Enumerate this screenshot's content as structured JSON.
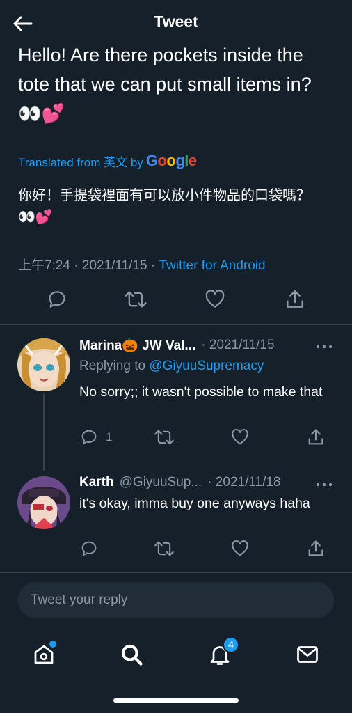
{
  "header": {
    "title": "Tweet"
  },
  "tweet": {
    "text": "Hello! Are there pockets inside the tote that we can put small items in? 👀💕",
    "translated_prefix": "Translated from 英文 by",
    "google_letters": [
      "G",
      "o",
      "o",
      "g",
      "l",
      "e"
    ],
    "translation": "你好！手提袋裡面有可以放小件物品的口袋嗎？ 👀💕",
    "time": "上午7:24",
    "date": "2021/11/15",
    "separator": "·",
    "source": "Twitter for Android"
  },
  "replies": [
    {
      "name": "Marina🎃 JW Val...",
      "handle": "",
      "date": "· 2021/11/15",
      "replying_prefix": "Replying to",
      "replying_to": "@GiyuuSupremacy",
      "text": "No sorry;; it wasn't possible to make that",
      "reply_count": "1"
    },
    {
      "name": "Karth",
      "handle": "@GiyuuSup...",
      "date": "· 2021/11/18",
      "text": "it's okay, imma buy one anyways haha",
      "reply_count": ""
    }
  ],
  "composer": {
    "placeholder": "Tweet your reply"
  },
  "nav": {
    "notifications_badge": "4"
  },
  "colors": {
    "background": "#15202b",
    "accent": "#1d9bf0",
    "muted": "#8b98a5",
    "divider": "#38444d"
  }
}
